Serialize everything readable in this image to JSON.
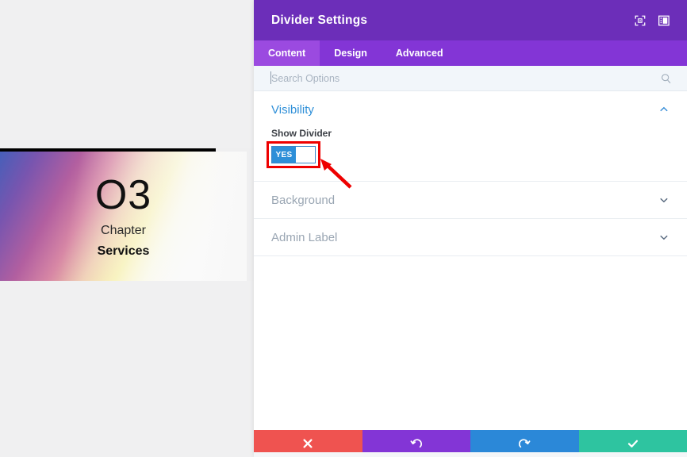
{
  "preview": {
    "chapter_number": "O3",
    "chapter_word": "Chapter",
    "chapter_title": "Services",
    "divider_color": "#000000",
    "gradient_colors": [
      "#465FB9",
      "#7855AF",
      "#B25FA0",
      "#D787A5",
      "#F7EE96",
      "#FFFFFF"
    ]
  },
  "panel": {
    "title": "Divider Settings",
    "header_icons": [
      {
        "name": "fullscreen-icon",
        "glyph": "expand"
      },
      {
        "name": "layout-view-icon",
        "glyph": "panel"
      }
    ],
    "tabs": [
      {
        "label": "Content",
        "active": true
      },
      {
        "label": "Design",
        "active": false
      },
      {
        "label": "Advanced",
        "active": false
      }
    ],
    "search": {
      "placeholder": "Search Options",
      "value": "",
      "icon": "search-icon"
    },
    "sections": [
      {
        "id": "visibility",
        "label": "Visibility",
        "expanded": true,
        "chevron": "chevron-up-icon",
        "color": "#2e8fd8"
      },
      {
        "id": "background",
        "label": "Background",
        "expanded": false,
        "chevron": "chevron-down-icon",
        "color": "#9aa6b3"
      },
      {
        "id": "admin-label",
        "label": "Admin Label",
        "expanded": false,
        "chevron": "chevron-down-icon",
        "color": "#9aa6b3"
      }
    ],
    "visibility": {
      "field_label": "Show Divider",
      "toggle_value": "YES",
      "toggle_state": "on",
      "toggle_color": "#2e8fd8"
    },
    "annotation": {
      "highlight_color": "#ee0000",
      "arrow_color": "#ee0000",
      "target": "show-divider-toggle"
    },
    "actions": [
      {
        "id": "cancel",
        "name": "cancel-button",
        "glyph": "✖",
        "color": "#ef5350"
      },
      {
        "id": "undo",
        "name": "undo-button",
        "glyph": "↺",
        "color": "#8335d6"
      },
      {
        "id": "redo",
        "name": "redo-button",
        "glyph": "↻",
        "color": "#2b88d8"
      },
      {
        "id": "save",
        "name": "save-button",
        "glyph": "✔",
        "color": "#2ec4a0"
      }
    ],
    "colors": {
      "header_bg": "#6c2eb9",
      "tabs_bg": "#8335d6",
      "tab_active_bg": "#9b4ae0",
      "search_bg": "#f2f6fa"
    }
  }
}
